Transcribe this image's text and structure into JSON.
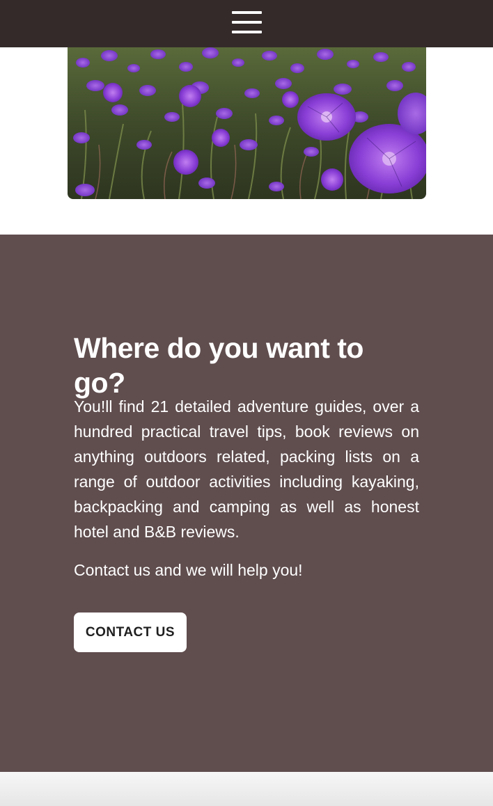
{
  "header": {
    "menu_icon": "hamburger-menu-icon",
    "background": "#342a2a"
  },
  "hero": {
    "image_subject": "purple wild geranium flowers in a meadow"
  },
  "promo": {
    "background": "#604d4e",
    "title": "Where do you want to go?",
    "body": "You!ll find 21 detailed adventure guides, over a hundred practical travel tips, book reviews on anything outdoors related, packing lists on a range of outdoor activities including kayaking, backpacking and camping as well as honest hotel and B&B reviews.",
    "cta_text": "Contact us and we will help you!",
    "button_label": "CONTACT US"
  }
}
